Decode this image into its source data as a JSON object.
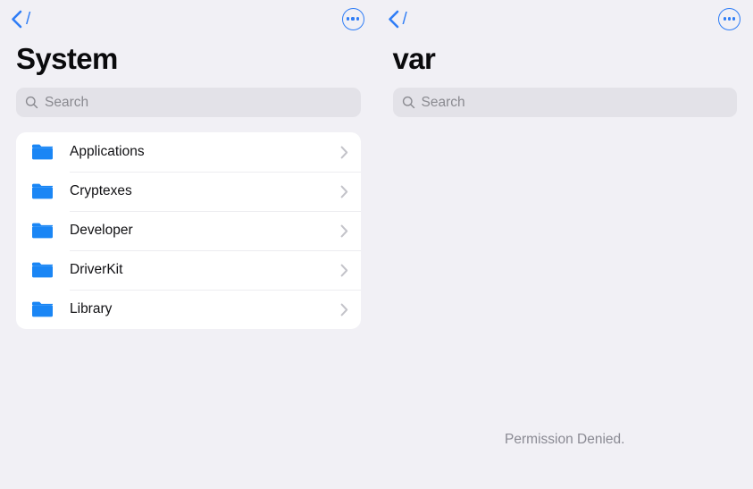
{
  "panes": [
    {
      "nav": {
        "back_icon": "chevron-left-icon",
        "back_label": "/",
        "more_icon": "ellipsis-circle-icon"
      },
      "title": "System",
      "search": {
        "icon": "search-icon",
        "placeholder": "Search",
        "value": ""
      },
      "items": [
        {
          "icon": "folder-icon",
          "label": "Applications",
          "accessory": "chevron-right-icon"
        },
        {
          "icon": "folder-icon",
          "label": "Cryptexes",
          "accessory": "chevron-right-icon"
        },
        {
          "icon": "folder-icon",
          "label": "Developer",
          "accessory": "chevron-right-icon"
        },
        {
          "icon": "folder-icon",
          "label": "DriverKit",
          "accessory": "chevron-right-icon"
        },
        {
          "icon": "folder-icon",
          "label": "Library",
          "accessory": "chevron-right-icon"
        }
      ],
      "message": ""
    },
    {
      "nav": {
        "back_icon": "chevron-left-icon",
        "back_label": "/",
        "more_icon": "ellipsis-circle-icon"
      },
      "title": "var",
      "search": {
        "icon": "search-icon",
        "placeholder": "Search",
        "value": ""
      },
      "items": [],
      "message": "Permission Denied."
    }
  ],
  "colors": {
    "accent": "#2f7df6",
    "folder": "#1a86f5",
    "background": "#f1f0f5",
    "card": "#ffffff",
    "search_field": "#e3e2e8",
    "title_text": "#0a0a0c",
    "secondary_text": "#8a8a93",
    "divider": "#ececf0"
  }
}
